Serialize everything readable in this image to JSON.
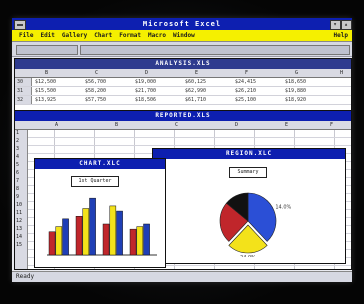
{
  "app": {
    "title": "Microsoft Excel"
  },
  "menu": [
    "File",
    "Edit",
    "Gallery",
    "Chart",
    "Format",
    "Macro",
    "Window"
  ],
  "menu_help": "Help",
  "windows": {
    "analysis": {
      "title": "ANALYSIS.XLS",
      "columns": [
        "B",
        "C",
        "D",
        "E",
        "F",
        "G",
        "H"
      ],
      "rows": [
        {
          "num": "30",
          "cells": [
            "$12,500",
            "$56,700",
            "$19,000",
            "$60,125",
            "$24,415",
            "$18,650"
          ]
        },
        {
          "num": "31",
          "cells": [
            "$15,500",
            "$58,200",
            "$21,700",
            "$62,990",
            "$26,210",
            "$19,880"
          ]
        },
        {
          "num": "32",
          "cells": [
            "$13,925",
            "$57,750",
            "$18,506",
            "$61,710",
            "$25,100",
            "$18,920"
          ]
        }
      ]
    },
    "reported": {
      "title": "REPORTED.XLS",
      "columns": [
        "A",
        "B",
        "C",
        "D",
        "E",
        "F"
      ],
      "row_nums": [
        "1",
        "2",
        "3",
        "4",
        "5",
        "6",
        "7",
        "8",
        "9",
        "10",
        "11",
        "12",
        "13",
        "14",
        "15"
      ]
    },
    "chart": {
      "title": "CHART.XLC",
      "button": "1st Quarter",
      "chart_data": {
        "type": "bar",
        "categories": [
          "1",
          "2",
          "3",
          "4"
        ],
        "series": [
          {
            "values": [
              45,
              75,
              60,
              50
            ]
          },
          {
            "values": [
              55,
              90,
              95,
              55
            ]
          },
          {
            "values": [
              70,
              110,
              85,
              60
            ]
          }
        ],
        "ylim": [
          0,
          120
        ],
        "colors": [
          "#c0262b",
          "#f3e21a",
          "#1f3fb6"
        ]
      }
    },
    "region": {
      "title": "REGION.XLC",
      "button": "Summary",
      "chart_data": {
        "type": "pie",
        "values": [
          38,
          24,
          24,
          14
        ],
        "colors": [
          "#2b4fd6",
          "#f3e21a",
          "#c0262b",
          "#111111"
        ],
        "labels": [
          "14.0%",
          "24.0%",
          "",
          ""
        ]
      }
    }
  },
  "status": {
    "text": "Ready"
  },
  "colors": {
    "titlebar": "#0d1fb0",
    "menubar": "#f5f000"
  }
}
